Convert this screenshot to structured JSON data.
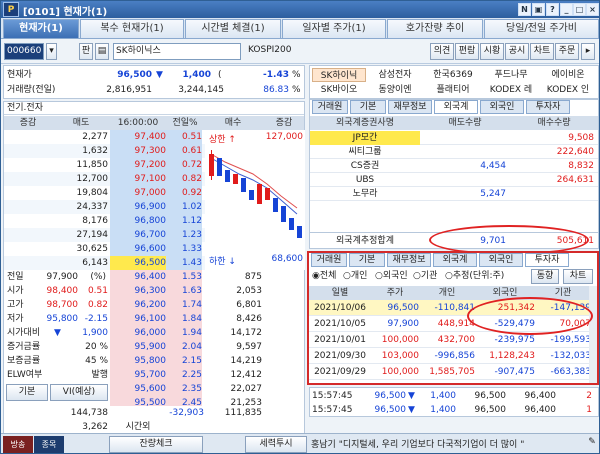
{
  "window": {
    "title": "[0101] 현재가(1)",
    "logo": "P",
    "buttons": [
      "N",
      "▣",
      "?",
      "_",
      "□",
      "×"
    ]
  },
  "tabs": [
    "현재가(1)",
    "복수 현재가(1)",
    "시간별 체결(1)",
    "일자별 주가(1)",
    "호가잔량 추이",
    "당일/전일 주가비"
  ],
  "search": {
    "code": "000660",
    "dropdown": "판",
    "name": "SK하이닉스",
    "market": "KOSPI200"
  },
  "quick_buttons": [
    "의견",
    "편람",
    "시황",
    "공시",
    "차트",
    "주문"
  ],
  "quote": {
    "price_label": "현재가",
    "price": "96,500",
    "arrow": "▼",
    "change": "1,400",
    "change_pct": "-1.43",
    "pct_unit": "%",
    "vol_label": "거래량(전일)",
    "volume": "2,816,951",
    "prev_volume": "3,244,145",
    "vol_ratio": "86.83",
    "sector": "전기.전자"
  },
  "stocks": [
    [
      "SK하이닉",
      "삼성전자",
      "한국6369",
      "푸드나무",
      "에이비온"
    ],
    [
      "SK바이오",
      "동양이엔",
      "플래티어",
      "KODEX 레",
      "KODEX 인"
    ]
  ],
  "orderbook": {
    "headers": [
      "증감",
      "매도",
      "16:00:00",
      "전일%",
      "매수",
      "증감"
    ],
    "asks": [
      [
        "",
        "2,277",
        "97,400",
        "0.51"
      ],
      [
        "",
        "1,632",
        "97,300",
        "0.61"
      ],
      [
        "",
        "11,850",
        "97,200",
        "0.72"
      ],
      [
        "",
        "12,700",
        "97,100",
        "0.82"
      ],
      [
        "",
        "19,804",
        "97,000",
        "0.92"
      ],
      [
        "",
        "24,337",
        "96,900",
        "1.02"
      ],
      [
        "",
        "8,176",
        "96,800",
        "1.12"
      ],
      [
        "",
        "27,194",
        "96,700",
        "1.23"
      ],
      [
        "",
        "30,625",
        "96,600",
        "1.33"
      ],
      [
        "",
        "6,143",
        "96,500",
        "1.43"
      ]
    ],
    "bids": [
      [
        "96,400",
        "1.53",
        "875"
      ],
      [
        "96,300",
        "1.63",
        "2,053"
      ],
      [
        "96,200",
        "1.74",
        "6,801"
      ],
      [
        "96,100",
        "1.84",
        "8,426"
      ],
      [
        "96,000",
        "1.94",
        "14,172"
      ],
      [
        "95,900",
        "2.04",
        "9,597"
      ],
      [
        "95,800",
        "2.15",
        "14,219"
      ],
      [
        "95,700",
        "2.25",
        "12,412"
      ],
      [
        "95,600",
        "2.35",
        "22,027"
      ],
      [
        "95,500",
        "2.45",
        "21,253"
      ]
    ],
    "ask_total": "144,738",
    "bid_total": "111,835",
    "net": "-32,903",
    "after": "3,262",
    "after_label": "시간외",
    "chart": {
      "high_label": "상한",
      "high": "127,000",
      "low_label": "하한",
      "low": "68,600"
    }
  },
  "info": {
    "prev_label": "전일",
    "prev": "97,900",
    "pct_label": "(%)",
    "rows": [
      [
        "시가",
        "98,400",
        "0.51"
      ],
      [
        "고가",
        "98,700",
        "0.82"
      ],
      [
        "저가",
        "95,800",
        "-2.15"
      ]
    ],
    "vi_label": "시가대비",
    "vi_value": "1,900",
    "margin": [
      [
        "증거금률",
        "20 %"
      ],
      [
        "보증금률",
        "45 %"
      ],
      [
        "ELW여부",
        "발행"
      ]
    ],
    "basic": "기본",
    "vi": "VI(예상)"
  },
  "foreign": {
    "tabs": [
      "거래원",
      "기본",
      "재무정보",
      "외국계",
      "외국인",
      "투자자"
    ],
    "headers": [
      "외국계증권사명",
      "매도수량",
      "매수수량"
    ],
    "rows": [
      [
        "JP모간",
        "",
        "9,508"
      ],
      [
        "씨티그룹",
        "",
        "222,640"
      ],
      [
        "CS증권",
        "4,454",
        "8,832"
      ],
      [
        "UBS",
        "",
        "264,631"
      ],
      [
        "노무라",
        "5,247",
        ""
      ]
    ],
    "total_label": "외국계추정합계",
    "total_sell": "9,701",
    "total_buy": "505,611"
  },
  "investor": {
    "tabs": [
      "거래원",
      "기본",
      "재무정보",
      "외국계",
      "외국인",
      "투자자"
    ],
    "filters": [
      "전체",
      "개인",
      "외국인",
      "기관",
      "추정(단위:주)"
    ],
    "btn1": "동향",
    "btn2": "차트",
    "headers": [
      "일별",
      "주가",
      "개인",
      "외국인",
      "기관"
    ],
    "rows": [
      [
        "2021/10/06",
        "96,500",
        "-110,841",
        "251,342",
        "-147,139"
      ],
      [
        "2021/10/05",
        "97,900",
        "448,914",
        "-529,479",
        "70,007"
      ],
      [
        "2021/10/01",
        "100,000",
        "432,700",
        "-239,975",
        "-199,593"
      ],
      [
        "2021/09/30",
        "103,000",
        "-996,856",
        "1,128,243",
        "-132,033"
      ],
      [
        "2021/09/29",
        "100,000",
        "1,585,705",
        "-907,475",
        "-663,383"
      ]
    ]
  },
  "ticks": [
    [
      "15:57:45",
      "96,500",
      "1,400",
      "96,500",
      "96,400",
      "2"
    ],
    [
      "15:57:45",
      "96,500",
      "1,400",
      "96,500",
      "96,400",
      "1"
    ]
  ],
  "status": {
    "left": "방송",
    "vod": "종목VOD",
    "mid": "잔량체크",
    "right": "세력투시",
    "news": "홍남기 \"디지털세, 우리 기업보다 다국적기업이 더 많이 \""
  }
}
